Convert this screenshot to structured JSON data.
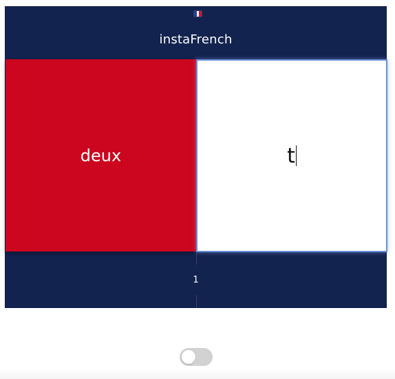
{
  "header": {
    "flag_icon": "france-flag-icon",
    "title": "instaFrench"
  },
  "card": {
    "prompt_word": "deux",
    "answer_value": "t",
    "prompt_color": "#cc061e"
  },
  "footer": {
    "counter": "1"
  },
  "toggle": {
    "state": "off"
  },
  "colors": {
    "navy": "#13234f",
    "red": "#cc061e",
    "focus_border": "#6b8ed6"
  }
}
